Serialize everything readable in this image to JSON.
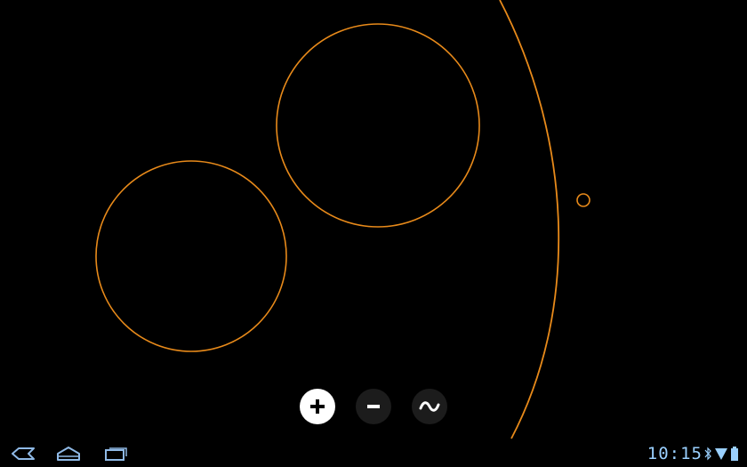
{
  "theme": {
    "background": "#000000",
    "shape_stroke": "#e88a1a",
    "button_active_bg": "#ffffff",
    "button_inactive_bg": "#1c1c1c",
    "status_blue": "#9ad0ff"
  },
  "canvas": {
    "shapes": [
      {
        "kind": "circle",
        "name": "large-circle-left"
      },
      {
        "kind": "circle",
        "name": "large-circle-top"
      },
      {
        "kind": "arc",
        "name": "large-arc-right"
      },
      {
        "kind": "circle",
        "name": "small-circle"
      }
    ]
  },
  "controls": {
    "add": {
      "icon": "plus-icon",
      "state": "active"
    },
    "remove": {
      "icon": "minus-icon",
      "state": "inactive"
    },
    "wave": {
      "icon": "tilde-wave-icon",
      "state": "inactive"
    }
  },
  "navbar": {
    "back": {
      "icon": "back-icon"
    },
    "home": {
      "icon": "home-icon"
    },
    "recent": {
      "icon": "recent-apps-icon"
    }
  },
  "status": {
    "time": "10:15",
    "icons": [
      "bluetooth-icon",
      "wifi-icon",
      "battery-icon"
    ]
  }
}
